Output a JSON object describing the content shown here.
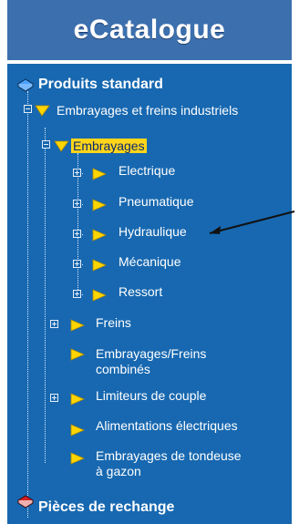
{
  "header": {
    "title": "eCatalogue"
  },
  "tree": {
    "root_standard": "Produits standard",
    "industrial": "Embrayages et freins industriels",
    "clutches": "Embrayages",
    "children_clutches": [
      "Electrique",
      "Pneumatique",
      "Hydraulique",
      "Mécanique",
      "Ressort"
    ],
    "freins": "Freins",
    "combined": "Embrayages/Freins combinés",
    "limiters": "Limiteurs de couple",
    "power": "Alimentations électriques",
    "mower": "Embrayages de tondeuse à gazon",
    "root_parts": "Pièces de rechange"
  },
  "colors": {
    "panel": "#1768b0",
    "header": "#3c6fae",
    "highlight": "#ffd51a",
    "arrow": "#ffd500",
    "book_blue": "#4aa3ff",
    "book_red": "#d61f1f"
  },
  "icons": {
    "arrow": "arrow-right-icon",
    "book": "book-icon",
    "plus": "plus-box-icon",
    "minus": "minus-box-icon"
  }
}
